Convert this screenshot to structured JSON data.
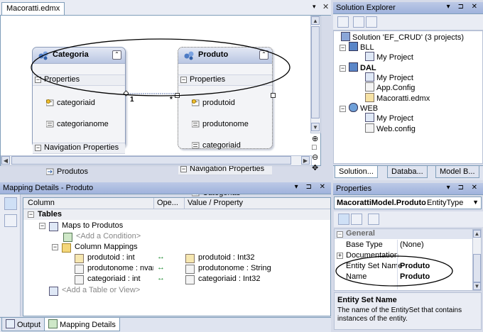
{
  "designer": {
    "tab_label": "Macoratti.edmx",
    "entities": [
      {
        "name": "Categoria",
        "properties_label": "Properties",
        "properties": [
          "categoriaid",
          "categorianome"
        ],
        "nav_label": "Navigation Properties",
        "nav_props": [
          "Produtos"
        ]
      },
      {
        "name": "Produto",
        "properties_label": "Properties",
        "properties": [
          "produtoid",
          "produtonome",
          "categoriaid"
        ],
        "nav_label": "Navigation Properties",
        "nav_props": [
          "Categorias"
        ]
      }
    ],
    "association": {
      "left_multiplicity": "1",
      "right_multiplicity": "*"
    }
  },
  "solution_explorer": {
    "title": "Solution Explorer",
    "items": [
      {
        "label": "Solution 'EF_CRUD' (3 projects)"
      },
      {
        "label": "BLL"
      },
      {
        "label": "My Project"
      },
      {
        "label": "DAL"
      },
      {
        "label": "My Project"
      },
      {
        "label": "App.Config"
      },
      {
        "label": "Macoratti.edmx"
      },
      {
        "label": "WEB"
      },
      {
        "label": "My Project"
      },
      {
        "label": "Web.config"
      }
    ],
    "tabs": [
      "Solution...",
      "Databa...",
      "Model B..."
    ]
  },
  "mapping": {
    "title": "Mapping Details - Produto",
    "columns": [
      "Column",
      "Ope...",
      "Value / Property"
    ],
    "tables_label": "Tables",
    "maps_to": "Maps to Produtos",
    "add_condition": "<Add a Condition>",
    "column_mappings_label": "Column Mappings",
    "rows": [
      {
        "column": "produtoid : int",
        "op": "↔",
        "value": "produtoid : Int32"
      },
      {
        "column": "produtonome : nvarch",
        "op": "↔",
        "value": "produtonome : String"
      },
      {
        "column": "categoriaid : int",
        "op": "↔",
        "value": "categoriaid : Int32"
      }
    ],
    "add_table": "<Add a Table or View>"
  },
  "bottom_tabs": [
    "Output",
    "Mapping Details"
  ],
  "properties": {
    "title": "Properties",
    "selector_name": "MacorattiModel.Produto",
    "selector_type": "EntityType",
    "category": "General",
    "rows": [
      {
        "name": "Base Type",
        "value": "(None)",
        "bold": false
      },
      {
        "name": "Documentation",
        "value": "",
        "bold": false
      },
      {
        "name": "Entity Set Name",
        "value": "Produto",
        "bold": true
      },
      {
        "name": "Name",
        "value": "Produto",
        "bold": true
      }
    ],
    "desc_title": "Entity Set Name",
    "desc_text": "The name of the EntitySet that contains instances of the entity."
  },
  "colors": {
    "accent": "#9fb2dc",
    "designer_bg": "#ffffff",
    "annotation": "#000000",
    "relation": "#6a7fb5"
  }
}
